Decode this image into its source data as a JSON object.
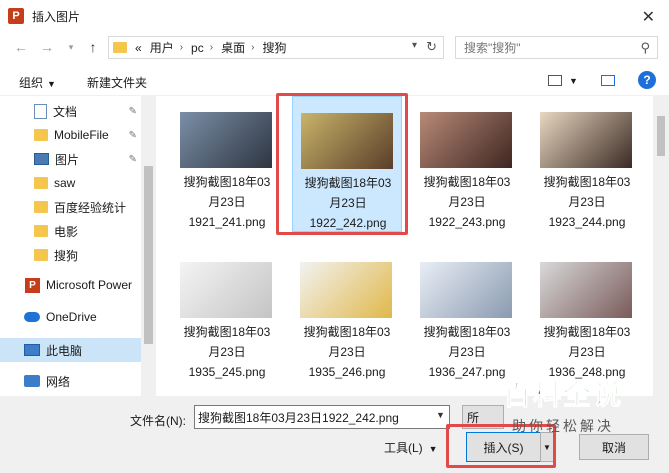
{
  "window": {
    "title": "插入图片"
  },
  "nav": {
    "breadcrumb": [
      "«",
      "用户",
      "pc",
      "桌面",
      "搜狗"
    ],
    "search_placeholder": "搜索\"搜狗\""
  },
  "toolbar": {
    "organize": "组织",
    "new_folder": "新建文件夹"
  },
  "sidebar": {
    "items": [
      {
        "label": "文档",
        "icon": "document-icon",
        "pinned": true
      },
      {
        "label": "MobileFile",
        "icon": "folder-icon",
        "pinned": true
      },
      {
        "label": "图片",
        "icon": "pictures-icon",
        "pinned": true
      },
      {
        "label": "saw",
        "icon": "folder-icon"
      },
      {
        "label": "百度经验统计",
        "icon": "folder-icon"
      },
      {
        "label": "电影",
        "icon": "folder-icon"
      },
      {
        "label": "搜狗",
        "icon": "folder-icon"
      },
      {
        "label": "Microsoft Power",
        "icon": "powerpoint-icon"
      },
      {
        "label": "OneDrive",
        "icon": "cloud-icon"
      },
      {
        "label": "此电脑",
        "icon": "computer-icon",
        "selected": true
      },
      {
        "label": "网络",
        "icon": "network-icon"
      }
    ]
  },
  "files": [
    {
      "name_lines": [
        "搜狗截图18年03",
        "月23日",
        "1921_241.png"
      ],
      "colors": [
        "#7b8fa8",
        "#2e3540"
      ]
    },
    {
      "name_lines": [
        "搜狗截图18年03",
        "月23日",
        "1922_242.png"
      ],
      "colors": [
        "#c9b46a",
        "#5a3d2a"
      ],
      "selected": true
    },
    {
      "name_lines": [
        "搜狗截图18年03",
        "月23日",
        "1922_243.png"
      ],
      "colors": [
        "#b88a78",
        "#3e2621"
      ]
    },
    {
      "name_lines": [
        "搜狗截图18年03",
        "月23日",
        "1923_244.png"
      ],
      "colors": [
        "#e8d7c0",
        "#3a2a24"
      ]
    },
    {
      "name_lines": [
        "搜狗截图18年03",
        "月23日",
        "1935_245.png"
      ],
      "colors": [
        "#f4f4f4",
        "#c4c4c4"
      ]
    },
    {
      "name_lines": [
        "搜狗截图18年03",
        "月23日",
        "1935_246.png"
      ],
      "colors": [
        "#f2f2f2",
        "#e0b84a"
      ]
    },
    {
      "name_lines": [
        "搜狗截图18年03",
        "月23日",
        "1936_247.png"
      ],
      "colors": [
        "#e9eef5",
        "#8a9ab0"
      ]
    },
    {
      "name_lines": [
        "搜狗截图18年03",
        "月23日",
        "1936_248.png"
      ],
      "colors": [
        "#d9d9d9",
        "#7a5a5a"
      ]
    }
  ],
  "footer": {
    "filename_label": "文件名(N):",
    "filename_value": "搜狗截图18年03月23日1922_242.png",
    "type_partial": "所",
    "tools_label": "工具(L)",
    "insert_label": "插入(S)",
    "cancel_label": "取消"
  },
  "watermark": {
    "title": "百科全说",
    "subtitle": "助你轻松解决"
  }
}
